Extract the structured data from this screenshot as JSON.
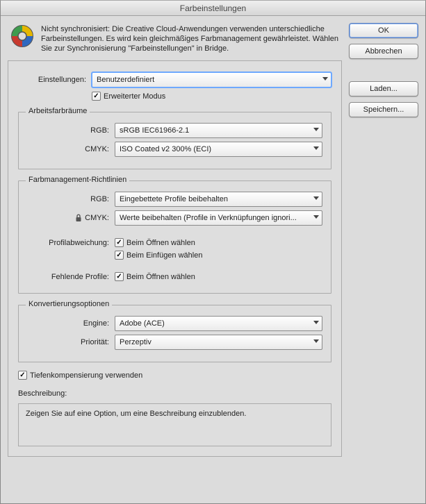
{
  "window": {
    "title": "Farbeinstellungen"
  },
  "notice": {
    "text": "Nicht synchronisiert: Die Creative Cloud-Anwendungen verwenden unterschiedliche Farbeinstellungen. Es wird kein gleichmäßiges Farbmanagement gewährleistet. Wählen Sie zur Synchronisierung \"Farbeinstellungen\" in Bridge."
  },
  "settings": {
    "label": "Einstellungen:",
    "value": "Benutzerdefiniert",
    "advanced_label": "Erweiterter Modus"
  },
  "workspaces": {
    "legend": "Arbeitsfarbräume",
    "rgb_label": "RGB:",
    "rgb_value": "sRGB IEC61966-2.1",
    "cmyk_label": "CMYK:",
    "cmyk_value": "ISO Coated v2 300% (ECI)"
  },
  "policies": {
    "legend": "Farbmanagement-Richtlinien",
    "rgb_label": "RGB:",
    "rgb_value": "Eingebettete Profile beibehalten",
    "cmyk_label": "CMYK:",
    "cmyk_value": "Werte beibehalten (Profile in Verknüpfungen ignori...",
    "mismatch_label": "Profilabweichung:",
    "mismatch_open": "Beim Öffnen wählen",
    "mismatch_paste": "Beim Einfügen wählen",
    "missing_label": "Fehlende Profile:",
    "missing_open": "Beim Öffnen wählen"
  },
  "conversion": {
    "legend": "Konvertierungsoptionen",
    "engine_label": "Engine:",
    "engine_value": "Adobe (ACE)",
    "intent_label": "Priorität:",
    "intent_value": "Perzeptiv",
    "blackpoint_label": "Tiefenkompensierung verwenden"
  },
  "description": {
    "label": "Beschreibung:",
    "placeholder": "Zeigen Sie auf eine Option, um eine Beschreibung einzublenden."
  },
  "buttons": {
    "ok": "OK",
    "cancel": "Abbrechen",
    "load": "Laden...",
    "save": "Speichern..."
  }
}
